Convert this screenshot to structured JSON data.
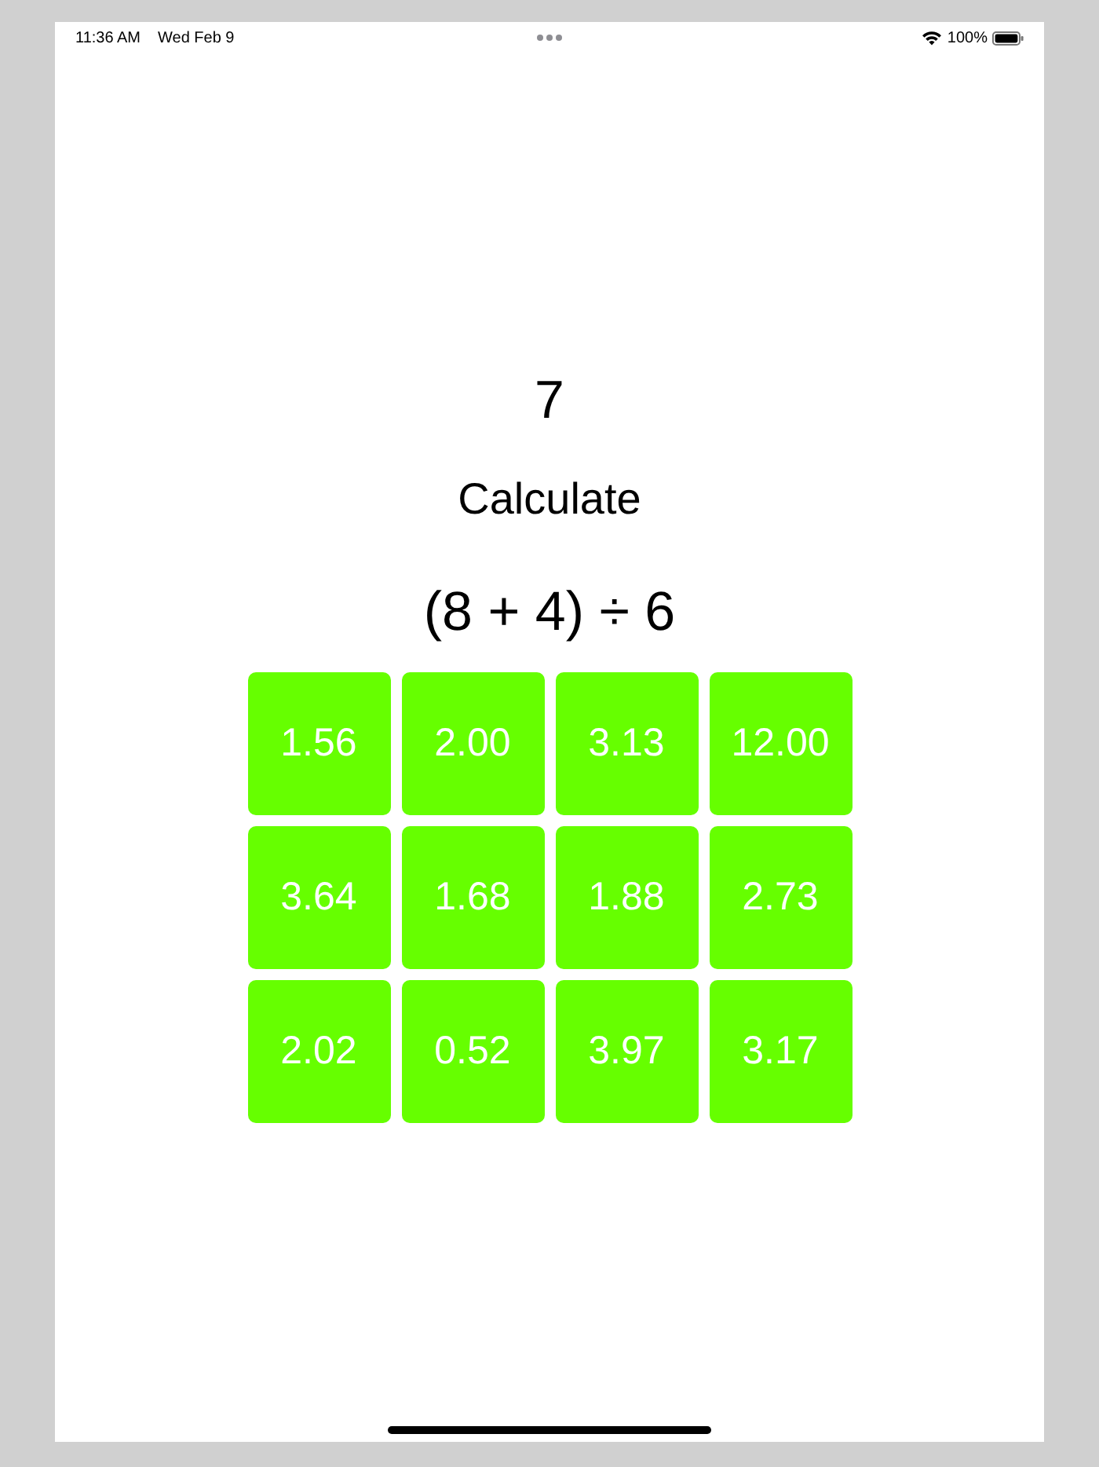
{
  "status_bar": {
    "time": "11:36 AM",
    "date": "Wed Feb 9",
    "battery": "100%"
  },
  "score": "7",
  "prompt": "Calculate",
  "expression": "(8 + 4) ÷ 6",
  "answers": [
    "1.56",
    "2.00",
    "3.13",
    "12.00",
    "3.64",
    "1.68",
    "1.88",
    "2.73",
    "2.02",
    "0.52",
    "3.97",
    "3.17"
  ]
}
